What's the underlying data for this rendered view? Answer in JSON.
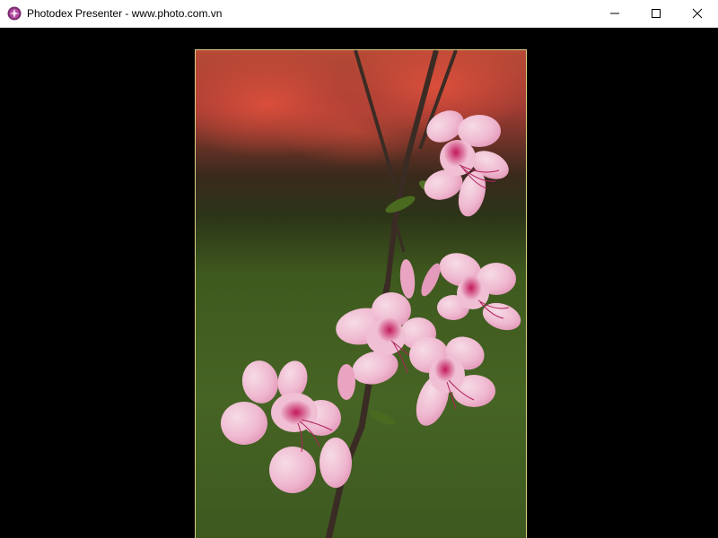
{
  "window": {
    "title": "Photodex Presenter - www.photo.com.vn",
    "app_icon": "photodex-logo-icon",
    "controls": {
      "minimize": "minimize-icon",
      "maximize": "maximize-icon",
      "close": "close-icon"
    }
  },
  "content": {
    "image_subject": "pink-flowers-photo",
    "frame_color": "#d9cf86",
    "background_color": "#000000"
  }
}
